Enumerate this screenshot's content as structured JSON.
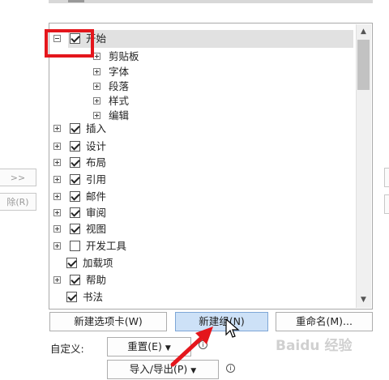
{
  "tree": {
    "items": [
      {
        "label": "开始",
        "checked": true,
        "expanded": true,
        "selected": true,
        "children": [
          "剪贴板",
          "字体",
          "段落",
          "样式",
          "编辑"
        ]
      },
      {
        "label": "插入",
        "checked": true
      },
      {
        "label": "设计",
        "checked": true
      },
      {
        "label": "布局",
        "checked": true
      },
      {
        "label": "引用",
        "checked": true
      },
      {
        "label": "邮件",
        "checked": true
      },
      {
        "label": "审阅",
        "checked": true
      },
      {
        "label": "视图",
        "checked": true
      },
      {
        "label": "开发工具",
        "checked": false
      },
      {
        "label": "加载项",
        "checked": true,
        "no_expander": true
      },
      {
        "label": "帮助",
        "checked": true
      },
      {
        "label": "书法",
        "checked": true,
        "no_expander": true
      }
    ]
  },
  "side_buttons": {
    "add_label": ">>",
    "remove_label": "除(R)"
  },
  "buttons": {
    "new_tab": "新建选项卡(W)",
    "new_group": "新建组(N)",
    "rename": "重命名(M)..."
  },
  "customize": {
    "label": "自定义:",
    "reset": "重置(E)",
    "import_export": "导入/导出(P)"
  },
  "icons": {
    "scroll_up": "up-arrow-icon",
    "scroll_down": "down-arrow-icon",
    "info": "info-icon",
    "dropdown": "dropdown-arrow-icon",
    "cursor": "mouse-pointer-icon",
    "annotation_arrow": "red-arrow-icon"
  },
  "colors": {
    "highlight_red": "#e4161c",
    "active_button": "#cde1f7",
    "selection": "#e1e1e1"
  },
  "watermark": "Baidu 经验"
}
